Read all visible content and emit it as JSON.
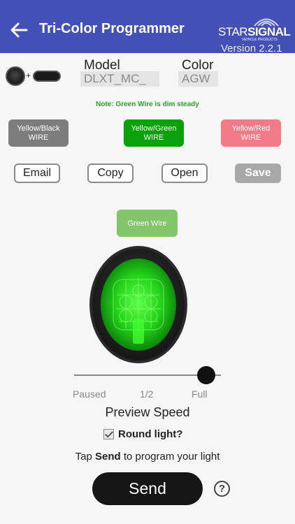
{
  "header": {
    "title": "Tri-Color Programmer",
    "brand": {
      "star": "STAR",
      "signal": "SIGNAL",
      "sub": "VEHICLE PRODUCTS"
    },
    "version": "Version 2.2.1",
    "color": "#4350b5"
  },
  "config": {
    "plus": "+",
    "model_label": "Model",
    "model_value": "DLXT_MC_",
    "color_label": "Color",
    "color_value": "AGW",
    "note": "Note: Green Wire is dim steady"
  },
  "wires": {
    "black": {
      "line1": "Yellow/Black",
      "line2": "WIRE",
      "color": "#7d7d7d"
    },
    "green": {
      "line1": "Yellow/Green",
      "line2": "WIRE",
      "color": "#0aa10a"
    },
    "red": {
      "line1": "Yellow/Red",
      "line2": "WIRE",
      "color": "#f07b86"
    }
  },
  "actions": {
    "email": "Email",
    "copy": "Copy",
    "open": "Open",
    "save": "Save"
  },
  "preview": {
    "active_wire_label": "Green Wire",
    "active_color": "#83c56b",
    "speed_value": 0.9,
    "speed_ticks": [
      "Paused",
      "1/2",
      "Full"
    ],
    "speed_label": "Preview Speed",
    "round_light_label": "Round light?",
    "round_light_checked": true
  },
  "footer": {
    "tap_prefix": "Tap ",
    "tap_bold": "Send",
    "tap_suffix": " to program your light",
    "send_label": "Send",
    "help_label": "?"
  }
}
